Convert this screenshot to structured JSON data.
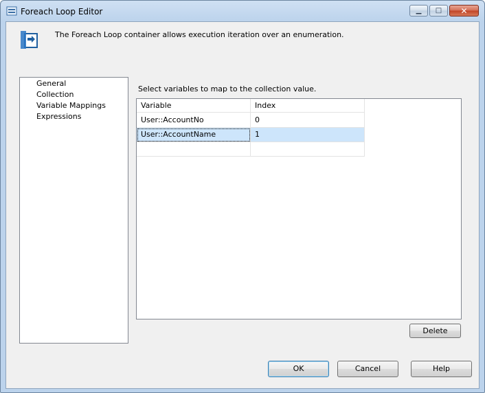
{
  "window": {
    "title": "Foreach Loop Editor"
  },
  "header": {
    "description": "The Foreach Loop container allows execution iteration over an enumeration."
  },
  "nav": {
    "items": [
      {
        "label": "General"
      },
      {
        "label": "Collection"
      },
      {
        "label": "Variable Mappings",
        "selected": true
      },
      {
        "label": "Expressions"
      }
    ]
  },
  "main": {
    "prompt": "Select variables to map to the collection value.",
    "grid": {
      "columns": [
        "Variable",
        "Index"
      ],
      "rows": [
        {
          "variable": "User::AccountNo",
          "index": "0",
          "selected": false
        },
        {
          "variable": "User::AccountName",
          "index": "1",
          "selected": true
        },
        {
          "variable": "",
          "index": "",
          "selected": false
        }
      ]
    },
    "delete_label": "Delete"
  },
  "footer": {
    "ok_label": "OK",
    "cancel_label": "Cancel",
    "help_label": "Help"
  },
  "colors": {
    "selection": "#cde5fb",
    "titlebar": "#bcd3ec",
    "close_button": "#c04326"
  }
}
